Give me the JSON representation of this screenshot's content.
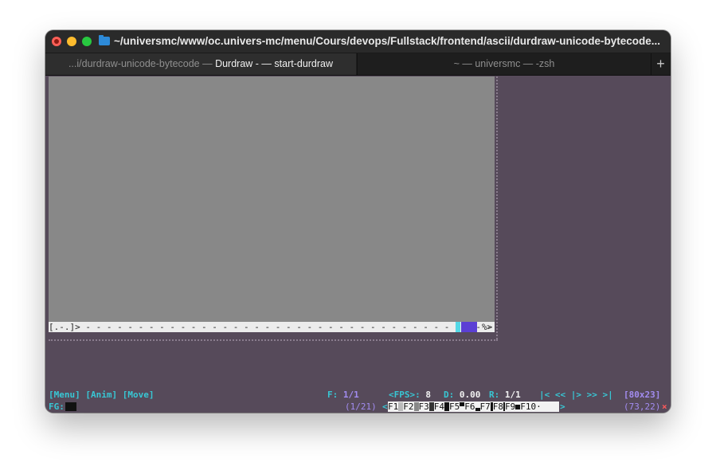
{
  "window": {
    "title": "~/universmc/www/oc.univers-mc/menu/Cours/devops/Fullstack/frontend/ascii/durdraw-unicode-bytecode..."
  },
  "tabs": [
    {
      "dim_part": "...i/durdraw-unicode-bytecode — ",
      "bright_part": "Durdraw -  — start-durdraw"
    },
    {
      "dim_part": "~ — ",
      "bright_part": "universmc — -zsh"
    }
  ],
  "tab_add_label": "+",
  "durdraw": {
    "canvas_status_left": "[.-.]> - - - - - - - - - - - - - - - - - - - - - - - - - - - - - - - - - - - - - - - - - - - -",
    "canvas_status_right": "%>",
    "menu": "[Menu]",
    "anim": "[Anim]",
    "move": "[Move]",
    "frame_label": "F:",
    "frame_value": "1/1",
    "fps_label": "<FPS>:",
    "fps_value": "8",
    "delay_label": "D:",
    "delay_value": "0.00",
    "range_label": "R:",
    "range_value": "1/1",
    "playback_controls": "|< << |> >> >|",
    "canvas_size": "[80x23]",
    "fg_label": "FG:",
    "char_page": "(1/21)",
    "fkeys_open": "<",
    "fkeys": [
      "F1",
      "F2",
      "F3",
      "F4",
      "F5",
      "F6",
      "F7",
      "F8",
      "F9",
      "F10"
    ],
    "fkeys_close": ">",
    "cursor_pos": "(73,22)",
    "close_marker": "×"
  },
  "colors": {
    "terminal_bg": "#564a5a",
    "canvas_bg": "#888888",
    "cyan": "#38c7d4",
    "lavender": "#a28cf0",
    "purple_block": "#5b3fd4"
  }
}
